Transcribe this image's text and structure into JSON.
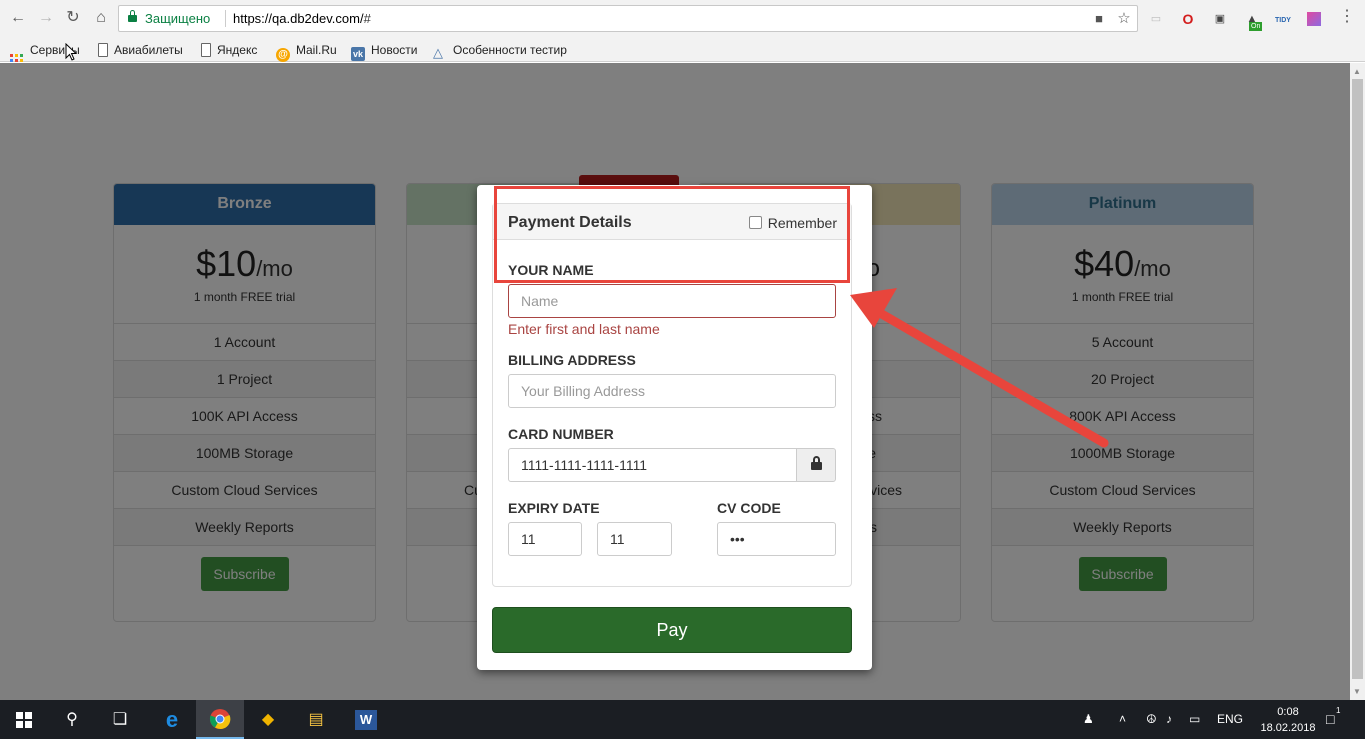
{
  "browser": {
    "secure_label": "Защищено",
    "url_host": "https://qa.db2dev.com/",
    "url_hash": "#",
    "bookmarks": [
      {
        "label": "Сервисы",
        "icon": "apps-grid-icon"
      },
      {
        "label": "Авиабилеты",
        "icon": "page-icon"
      },
      {
        "label": "Яндекс",
        "icon": "page-icon"
      },
      {
        "label": "Mail.Ru",
        "icon": "mailru-icon"
      },
      {
        "label": "Новости",
        "icon": "vk-icon"
      },
      {
        "label": "Особенности тестир",
        "icon": "flask-icon"
      }
    ],
    "ext_tidy_label": "TIDY",
    "ext_on_badge": "On"
  },
  "plans": [
    {
      "name": "Bronze",
      "price": "$10",
      "period": "/mo",
      "trial": "1 month FREE trial",
      "features": [
        "1 Account",
        "1 Project",
        "100K API Access",
        "100MB Storage",
        "Custom Cloud Services",
        "Weekly Reports"
      ],
      "button": "Subscribe"
    },
    {
      "name": "Platinum",
      "price": "$40",
      "period": "/mo",
      "trial": "1 month FREE trial",
      "features": [
        "5 Account",
        "20 Project",
        "800K API Access",
        "1000MB Storage",
        "Custom Cloud Services",
        "Weekly Reports"
      ],
      "button": "Subscribe"
    }
  ],
  "hidden_plans_fragments": {
    "silver_fragments": [
      "Cu"
    ],
    "gold_fragments": [
      "o",
      "ss",
      "e",
      "vices",
      "s"
    ]
  },
  "modal": {
    "title": "Payment Details",
    "remember_label": "Remember",
    "name_label": "YOUR NAME",
    "name_placeholder": "Name",
    "name_error": "Enter first and last name",
    "billing_label": "BILLING ADDRESS",
    "billing_placeholder": "Your Billing Address",
    "card_label": "CARD NUMBER",
    "card_value": "1111-1111-1111-1111",
    "expiry_label": "EXPIRY DATE",
    "expiry_month": "11",
    "expiry_year": "11",
    "cv_label": "CV CODE",
    "cv_value": "•••",
    "pay_label": "Pay"
  },
  "taskbar": {
    "lang": "ENG",
    "time": "0:08",
    "date": "18.02.2018",
    "notification_count": "1"
  },
  "colors": {
    "bronze_header": "#2f6eaa",
    "platinum_header": "#bcd6ec",
    "pay_green": "#2a6a2a",
    "error_red": "#a94442",
    "annotation_red": "#e8453c"
  }
}
